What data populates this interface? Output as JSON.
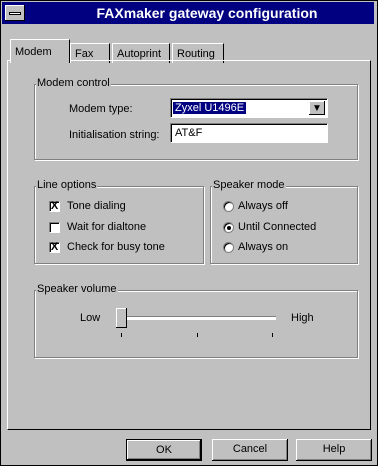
{
  "window": {
    "title": "FAXmaker gateway configuration"
  },
  "tabs": [
    {
      "label": "Modem",
      "active": true
    },
    {
      "label": "Fax"
    },
    {
      "label": "Autoprint"
    },
    {
      "label": "Routing"
    }
  ],
  "modem_control": {
    "legend": "Modem control",
    "modem_type_label": "Modem type:",
    "modem_type_value": "Zyxel U1496E",
    "init_label": "Initialisation string:",
    "init_value": "AT&F"
  },
  "line_options": {
    "legend": "Line options",
    "items": [
      {
        "label": "Tone dialing",
        "checked": true
      },
      {
        "label": "Wait for dialtone",
        "checked": false
      },
      {
        "label": "Check for busy tone",
        "checked": true
      }
    ]
  },
  "speaker_mode": {
    "legend": "Speaker mode",
    "options": [
      {
        "label": "Always off",
        "selected": false
      },
      {
        "label": "Until Connected",
        "selected": true
      },
      {
        "label": "Always on",
        "selected": false
      }
    ]
  },
  "speaker_volume": {
    "legend": "Speaker volume",
    "low": "Low",
    "high": "High",
    "level": 0
  },
  "buttons": {
    "ok": "OK",
    "cancel": "Cancel",
    "help": "Help"
  },
  "check_mark": "X",
  "dropdown_arrow": "▼"
}
